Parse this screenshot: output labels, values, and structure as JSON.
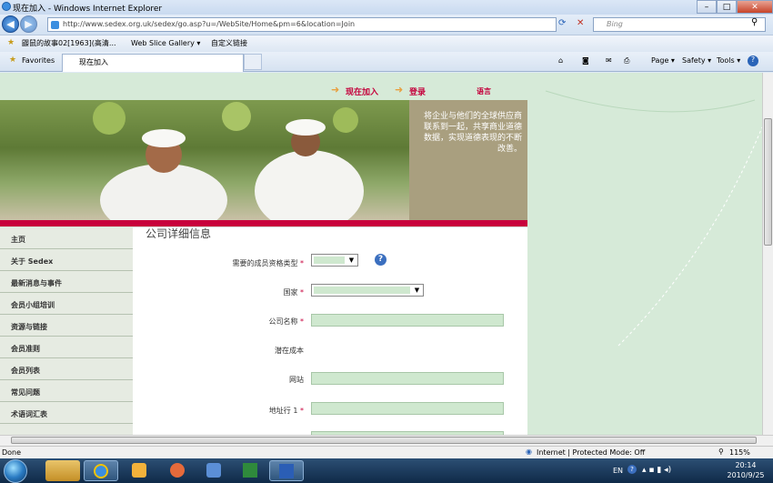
{
  "window": {
    "title": "现在加入 - Windows Internet Explorer",
    "minimize": "–",
    "maximize": "□",
    "close": "✕"
  },
  "address": {
    "url": "http://www.sedex.org.uk/sedex/go.asp?u=/WebSite/Home&pm=6&location=Join",
    "search_placeholder": "Bing"
  },
  "favbar": {
    "items": [
      "鼹鼠的故事02[1963](高清...",
      "Web Slice Gallery ▾",
      "自定义链接"
    ]
  },
  "tabs": {
    "favorites": "Favorites",
    "active_tab": "现在加入"
  },
  "commandbar": {
    "page": "Page ▾",
    "safety": "Safety ▾",
    "tools": "Tools ▾",
    "help": "?"
  },
  "site": {
    "join": "现在加入",
    "login": "登录",
    "language": "语言",
    "tagline": "将企业与他们的全球供应商联系到一起，共享商业道德数据，实现道德表现的不断改善。",
    "sidebar": [
      "主页",
      "关于 Sedex",
      "最新消息与事件",
      "会员小组培训",
      "资源与链接",
      "会员准则",
      "会员列表",
      "常见问题",
      "术语词汇表"
    ],
    "section_title": "公司详细信息",
    "form": {
      "membership_type": "需要的成员资格类型",
      "country": "国家",
      "company_name": "公司名称",
      "potential_cost": "潜在成本",
      "website": "网站",
      "address_line1": "地址行  1",
      "required_mark": "*"
    }
  },
  "status": {
    "left": "Done",
    "zone": "Internet | Protected Mode: Off",
    "zoom": "115%"
  },
  "taskbar": {
    "lang": "EN",
    "time": "20:14",
    "date": "2010/9/25"
  }
}
